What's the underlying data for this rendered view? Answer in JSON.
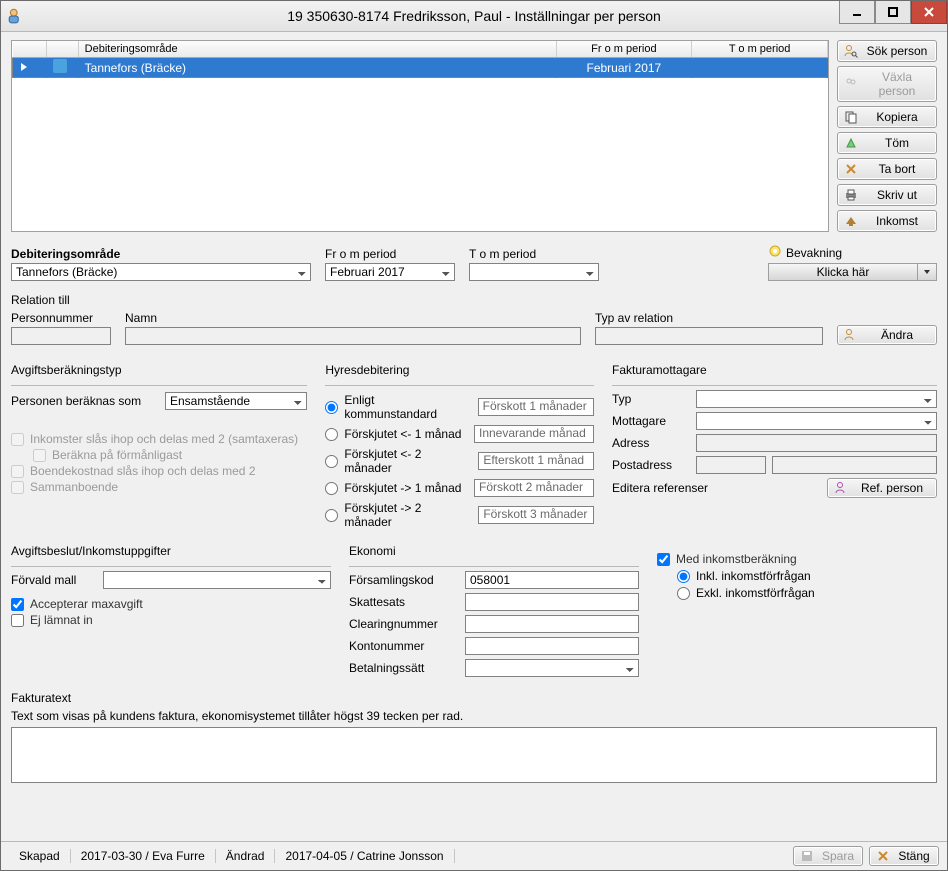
{
  "titlebar": {
    "title": "19 350630-8174 Fredriksson, Paul - Inställningar per person"
  },
  "side_buttons": {
    "sok": "Sök person",
    "vaxla": "Växla person",
    "kopiera": "Kopiera",
    "tom": "Töm",
    "tabort": "Ta bort",
    "skrivut": "Skriv ut",
    "inkomst": "Inkomst"
  },
  "table": {
    "headers": {
      "deb": "Debiteringsområde",
      "fr": "Fr o m period",
      "to": "T o m period"
    },
    "rows": [
      {
        "area": "Tannefors (Bräcke)",
        "from": "Februari 2017",
        "to": ""
      }
    ]
  },
  "combos": {
    "deb_lbl": "Debiteringsområde",
    "deb_val": "Tannefors (Bräcke)",
    "fr_lbl": "Fr o m period",
    "fr_val": "Februari 2017",
    "to_lbl": "T o m period",
    "to_val": ""
  },
  "bevak": {
    "lbl": "Bevakning",
    "btn": "Klicka här"
  },
  "relation": {
    "hdr": "Relation till",
    "pn_lbl": "Personnummer",
    "namn_lbl": "Namn",
    "typ_lbl": "Typ av relation",
    "pn_val": "",
    "namn_val": "",
    "typ_val": "",
    "andra": "Ändra"
  },
  "avg": {
    "hdr": "Avgiftsberäkningstyp",
    "beraknas_lbl": "Personen beräknas som",
    "beraknas_val": "Ensamstående",
    "chk1": "Inkomster slås ihop och delas med 2 (samtaxeras)",
    "chk1a": "Beräkna på förmånligast",
    "chk2": "Boendekostnad slås ihop och delas med 2",
    "chk3": "Sammanboende"
  },
  "hyres": {
    "hdr": "Hyresdebitering",
    "r1": "Enligt kommunstandard",
    "b1": "Förskott 1 månader",
    "r2": "Förskjutet <- 1 månad",
    "b2": "Innevarande månad",
    "r3": "Förskjutet <- 2 månader",
    "b3": "Efterskott 1 månad",
    "r4": "Förskjutet -> 1 månad",
    "b4": "Förskott 2 månader",
    "r5": "Förskjutet -> 2 månader",
    "b5": "Förskott 3 månader"
  },
  "fak": {
    "hdr": "Fakturamottagare",
    "typ": "Typ",
    "typ_val": "",
    "mott": "Mottagare",
    "mott_val": "",
    "adr": "Adress",
    "adr_val": "",
    "post": "Postadress",
    "post_val1": "",
    "post_val2": "",
    "editref": "Editera referenser",
    "refbtn": "Ref. person"
  },
  "avgb": {
    "hdr": "Avgiftsbeslut/Inkomstuppgifter",
    "mall_lbl": "Förvald mall",
    "mall_val": "",
    "acc": "Accepterar maxavgift",
    "ej": "Ej lämnat in"
  },
  "eko": {
    "hdr": "Ekonomi",
    "fors": "Församlingskod",
    "fors_val": "058001",
    "skat": "Skattesats",
    "skat_val": "",
    "clr": "Clearingnummer",
    "clr_val": "",
    "konto": "Kontonummer",
    "konto_val": "",
    "bet": "Betalningssätt",
    "bet_val": ""
  },
  "ink": {
    "med": "Med inkomstberäkning",
    "inkl": "Inkl. inkomstförfrågan",
    "exkl": "Exkl. inkomstförfrågan"
  },
  "faktxt": {
    "hdr": "Fakturatext",
    "hint": "Text som visas på kundens faktura, ekonomisystemet tillåter högst 39 tecken per rad.",
    "val": ""
  },
  "status": {
    "skapad_lbl": "Skapad",
    "skapad_val": "2017-03-30 / Eva Furre",
    "andrad_lbl": "Ändrad",
    "andrad_val": "2017-04-05 / Catrine Jonsson",
    "spara": "Spara",
    "stang": "Stäng"
  }
}
